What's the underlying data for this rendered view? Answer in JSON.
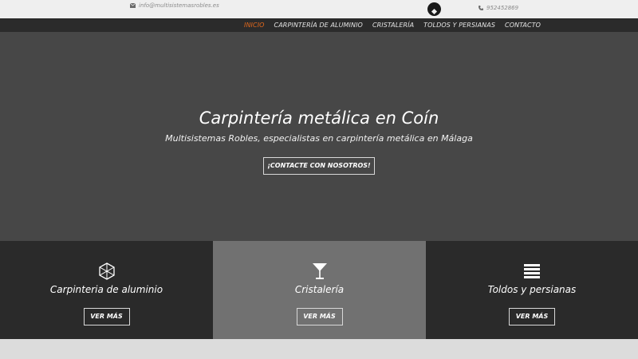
{
  "topbar": {
    "email": "info@multisistemasrobles.es",
    "email_icon": "envelope-icon",
    "logo_icon": "logo-icon",
    "phone": "952452869",
    "phone_icon": "phone-icon"
  },
  "nav": {
    "items": [
      {
        "label": "INICIO",
        "active": true
      },
      {
        "label": "CARPINTERÍA DE ALUMINIO",
        "active": false
      },
      {
        "label": "CRISTALERÍA",
        "active": false
      },
      {
        "label": "TOLDOS Y PERSIANAS",
        "active": false
      },
      {
        "label": "CONTACTO",
        "active": false
      }
    ],
    "active_color": "#e2681c"
  },
  "hero": {
    "title": "Carpintería metálica en Coín",
    "subtitle": "Multisistemas Robles, especialistas en carpintería metálica en Málaga",
    "button": "¡CONTACTE CON NOSOTROS!"
  },
  "panels": [
    {
      "icon": "hexagon-cube-icon",
      "title": "Carpinteria de aluminio",
      "button": "VER MÁS"
    },
    {
      "icon": "cocktail-glass-icon",
      "title": "Cristalería",
      "button": "VER MÁS"
    },
    {
      "icon": "blinds-icon",
      "title": "Toldos y persianas",
      "button": "VER MÁS"
    }
  ]
}
